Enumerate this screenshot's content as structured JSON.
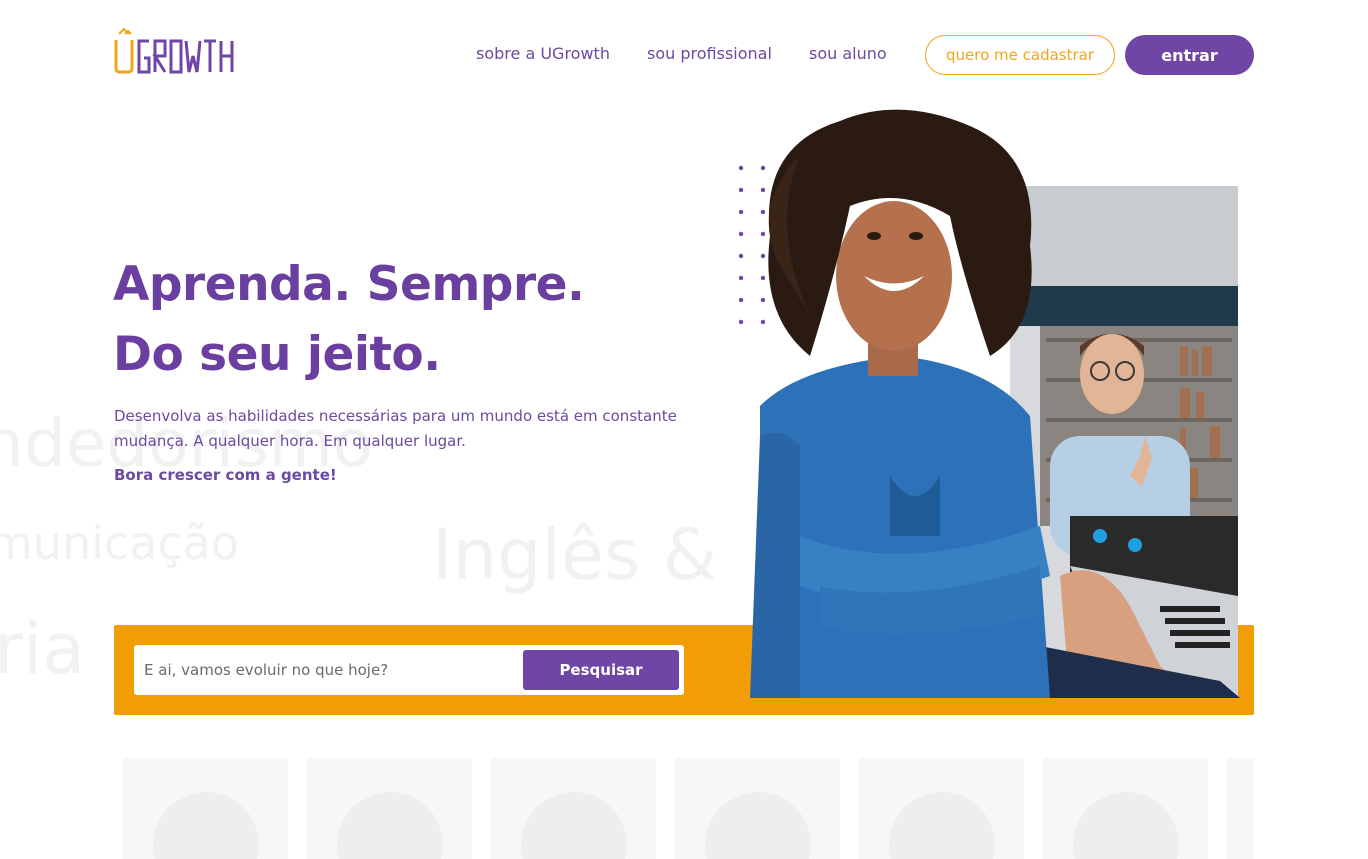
{
  "header": {
    "logo_text": "UGROWTH",
    "nav": [
      {
        "label": "sobre a UGrowth"
      },
      {
        "label": "sou profissional"
      },
      {
        "label": "sou aluno"
      }
    ],
    "signup_label": "quero me cadastrar",
    "login_label": "entrar"
  },
  "hero": {
    "title_line1": "Aprenda. Sempre.",
    "title_line2": "Do seu jeito.",
    "description": "Desenvolva as habilidades necessárias para um mundo está em constante mudança. A qualquer hora. Em qualquer lugar.",
    "cta": "Bora crescer com a gente!"
  },
  "background_words": [
    "ndedorismo",
    "municação",
    "Inglês &",
    "ria"
  ],
  "search": {
    "placeholder": "E ai, vamos evoluir no que hoje?",
    "button_label": "Pesquisar"
  },
  "colors": {
    "brand_purple": "#6f45a5",
    "brand_orange": "#f29c06"
  },
  "cards_count": 7
}
